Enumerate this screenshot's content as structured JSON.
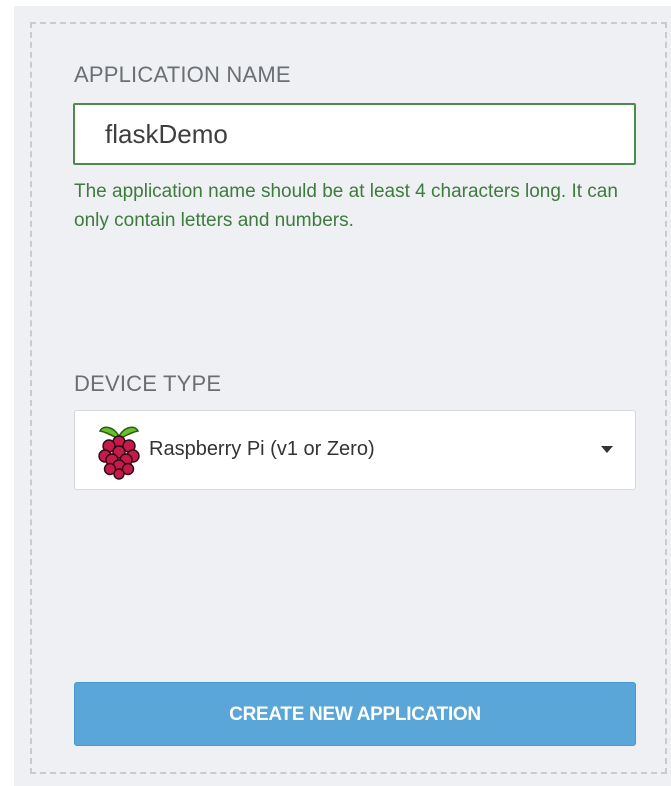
{
  "form": {
    "app_name": {
      "label": "APPLICATION NAME",
      "value": "flaskDemo",
      "help_text": "The application name should be at least 4 characters long. It can only contain letters and numbers."
    },
    "device_type": {
      "label": "DEVICE TYPE",
      "selected": "Raspberry Pi (v1 or Zero)",
      "icon": "raspberry-pi-icon"
    },
    "submit": {
      "label": "CREATE NEW APPLICATION"
    }
  },
  "colors": {
    "valid_green": "#3f7a3f",
    "button_blue": "#5aa6d8",
    "panel_bg": "#eef0f3"
  }
}
